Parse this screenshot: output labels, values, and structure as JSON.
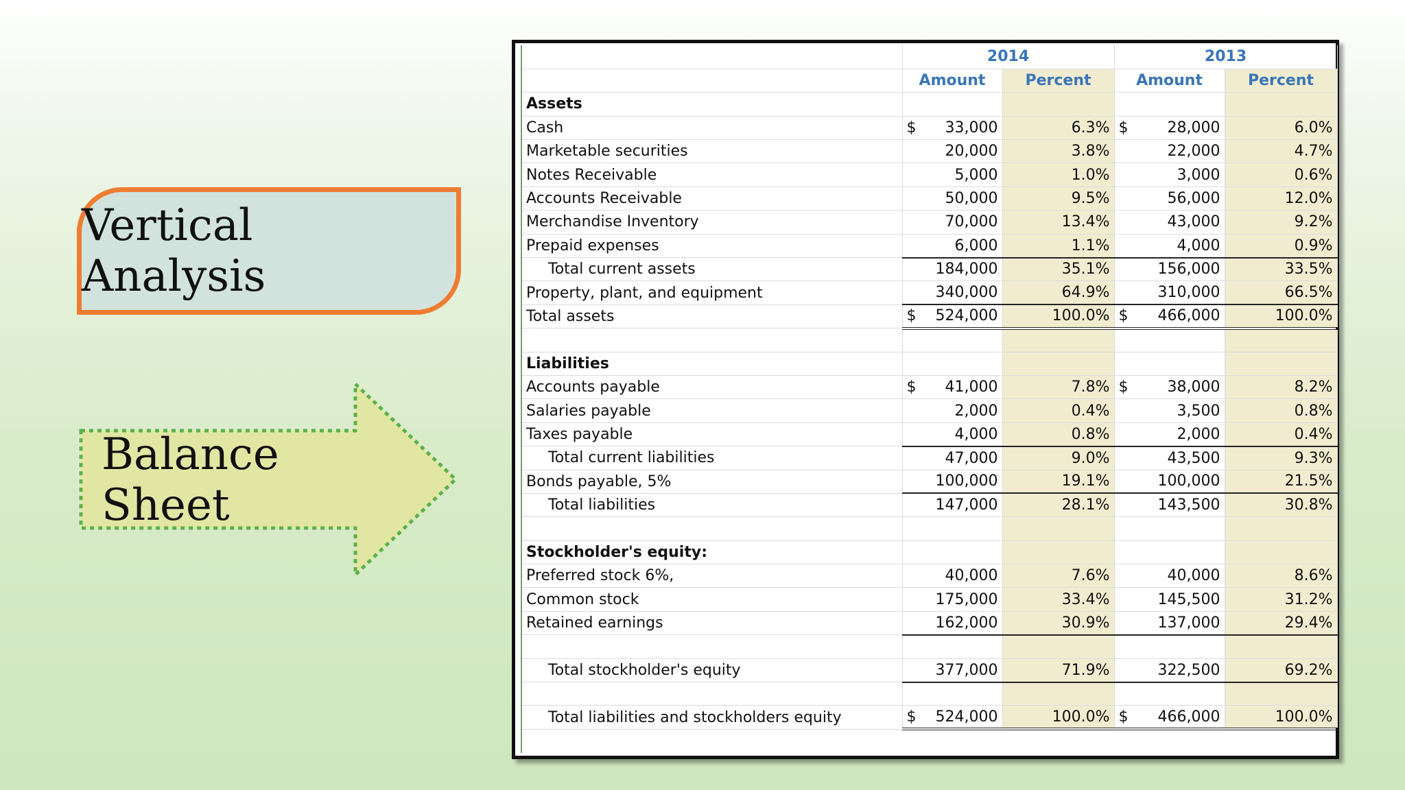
{
  "labels": {
    "vertical_analysis": "Vertical Analysis",
    "balance_sheet": "Balance Sheet"
  },
  "colors": {
    "callout_fill": "#d2e3de",
    "callout_border": "#ee7d31",
    "arrow_fill": "#e1e7a3",
    "arrow_border": "#5fb04a",
    "header_text": "#3a75b8",
    "percent_fill": "#f1ecd0"
  },
  "table": {
    "years": [
      "2014",
      "2013"
    ],
    "subheaders": [
      "Amount",
      "Percent",
      "Amount",
      "Percent"
    ],
    "rows": [
      {
        "label": "Assets",
        "style": "section"
      },
      {
        "label": "Cash",
        "cur": true,
        "a1": "33,000",
        "p1": "6.3%",
        "a2": "28,000",
        "p2": "6.0%"
      },
      {
        "label": "Marketable securities",
        "a1": "20,000",
        "p1": "3.8%",
        "a2": "22,000",
        "p2": "4.7%"
      },
      {
        "label": "Notes Receivable",
        "a1": "5,000",
        "p1": "1.0%",
        "a2": "3,000",
        "p2": "0.6%"
      },
      {
        "label": "Accounts Receivable",
        "a1": "50,000",
        "p1": "9.5%",
        "a2": "56,000",
        "p2": "12.0%"
      },
      {
        "label": "Merchandise Inventory",
        "a1": "70,000",
        "p1": "13.4%",
        "a2": "43,000",
        "p2": "9.2%"
      },
      {
        "label": "Prepaid expenses",
        "a1": "6,000",
        "p1": "1.1%",
        "a2": "4,000",
        "p2": "0.9%",
        "ul": true
      },
      {
        "label": "Total current assets",
        "indent": true,
        "a1": "184,000",
        "p1": "35.1%",
        "a2": "156,000",
        "p2": "33.5%"
      },
      {
        "label": "Property, plant, and equipment",
        "a1": "340,000",
        "p1": "64.9%",
        "a2": "310,000",
        "p2": "66.5%",
        "ul": true
      },
      {
        "label": "Total assets",
        "cur": true,
        "a1": "524,000",
        "p1": "100.0%",
        "a2": "466,000",
        "p2": "100.0%",
        "dl": true
      },
      {
        "label": "",
        "style": "blank"
      },
      {
        "label": "Liabilities",
        "style": "section"
      },
      {
        "label": "Accounts payable",
        "cur": true,
        "a1": "41,000",
        "p1": "7.8%",
        "a2": "38,000",
        "p2": "8.2%"
      },
      {
        "label": "Salaries payable",
        "a1": "2,000",
        "p1": "0.4%",
        "a2": "3,500",
        "p2": "0.8%"
      },
      {
        "label": "Taxes payable",
        "a1": "4,000",
        "p1": "0.8%",
        "a2": "2,000",
        "p2": "0.4%",
        "ul": true
      },
      {
        "label": "Total current liabilities",
        "indent": true,
        "a1": "47,000",
        "p1": "9.0%",
        "a2": "43,500",
        "p2": "9.3%"
      },
      {
        "label": "Bonds payable, 5%",
        "a1": "100,000",
        "p1": "19.1%",
        "a2": "100,000",
        "p2": "21.5%",
        "ul": true
      },
      {
        "label": "Total liabilities",
        "indent": true,
        "a1": "147,000",
        "p1": "28.1%",
        "a2": "143,500",
        "p2": "30.8%"
      },
      {
        "label": "",
        "style": "blank"
      },
      {
        "label": "Stockholder's equity:",
        "style": "section"
      },
      {
        "label": "Preferred stock 6%,",
        "a1": "40,000",
        "p1": "7.6%",
        "a2": "40,000",
        "p2": "8.6%"
      },
      {
        "label": "Common stock",
        "a1": "175,000",
        "p1": "33.4%",
        "a2": "145,500",
        "p2": "31.2%"
      },
      {
        "label": "Retained earnings",
        "a1": "162,000",
        "p1": "30.9%",
        "a2": "137,000",
        "p2": "29.4%",
        "ul": true
      },
      {
        "label": "",
        "style": "blank"
      },
      {
        "label": "Total stockholder's equity",
        "indent": true,
        "a1": "377,000",
        "p1": "71.9%",
        "a2": "322,500",
        "p2": "69.2%",
        "ul": true
      },
      {
        "label": "",
        "style": "blank"
      },
      {
        "label": "Total liabilities and stockholders equity",
        "indent": true,
        "cur": true,
        "a1": "524,000",
        "p1": "100.0%",
        "a2": "466,000",
        "p2": "100.0%",
        "dl": true
      }
    ],
    "currency_symbol": "$"
  }
}
